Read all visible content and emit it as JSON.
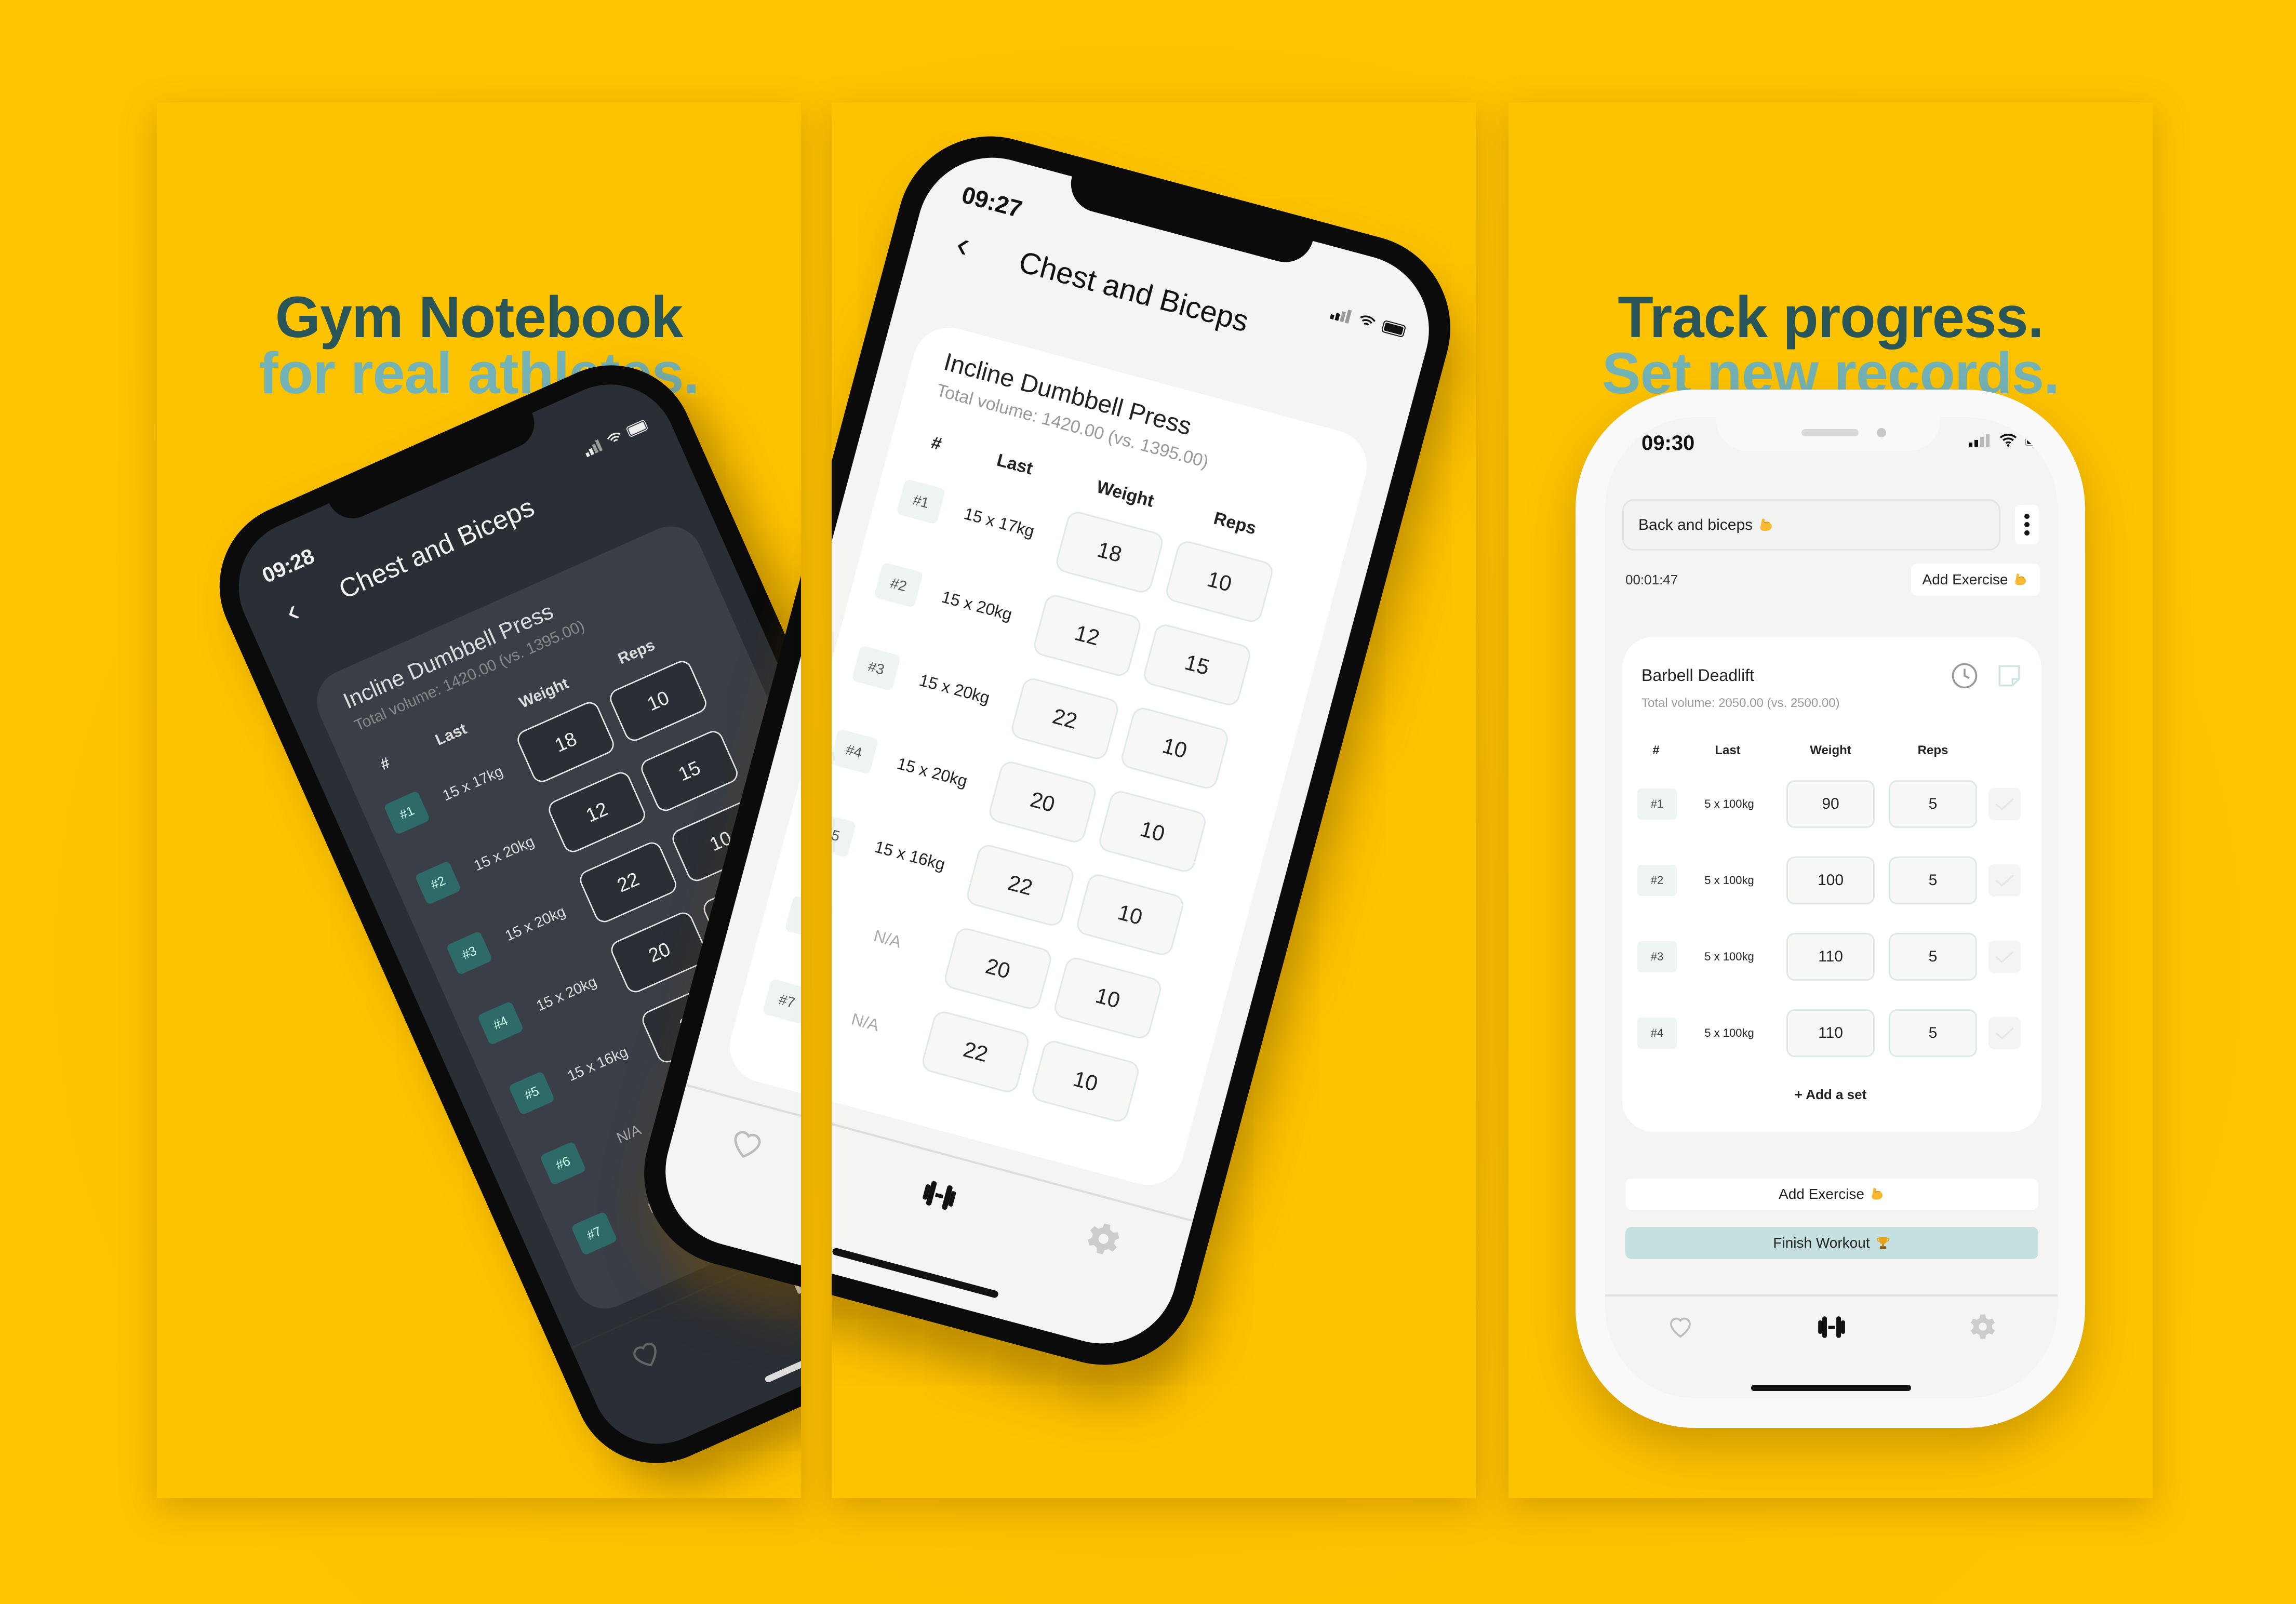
{
  "colors": {
    "background": "#fdc300",
    "headline_dark": "#2a5558",
    "headline_light": "#73b2b6",
    "finish_button": "#c5e0e1",
    "badge_dark": "#2e6a67"
  },
  "panel1": {
    "line1": "Gym Notebook",
    "line2": "for real athletes."
  },
  "panel3": {
    "line1": "Track progress.",
    "line2": "Set new records."
  },
  "dark_phone": {
    "time": "09:28",
    "title": "Chest and Biceps"
  },
  "middle_phone": {
    "time": "09:27",
    "title": "Chest and Biceps"
  },
  "rotated_workout": {
    "exercise": "Incline Dumbbell Press",
    "volume": "Total volume: 1420.00 (vs. 1395.00)",
    "headers": [
      "#",
      "Last",
      "Weight",
      "Reps"
    ],
    "sets": [
      {
        "n": "#1",
        "last": "15 x 17kg",
        "weight": "18",
        "reps": "10"
      },
      {
        "n": "#2",
        "last": "15 x 20kg",
        "weight": "12",
        "reps": "15"
      },
      {
        "n": "#3",
        "last": "15 x 20kg",
        "weight": "22",
        "reps": "10"
      },
      {
        "n": "#4",
        "last": "15 x 20kg",
        "weight": "20",
        "reps": "10"
      },
      {
        "n": "#5",
        "last": "15 x 16kg",
        "weight": "22",
        "reps": "10"
      },
      {
        "n": "#6",
        "last": "N/A",
        "weight": "20",
        "reps": "10"
      },
      {
        "n": "#7",
        "last": "N/A",
        "weight": "22",
        "reps": "10"
      }
    ]
  },
  "right_phone": {
    "time": "09:30",
    "workout_name": "Back and biceps",
    "workout_name_icon": "flexed-biceps",
    "timer": "00:01:47",
    "add_exercise_top": "Add Exercise",
    "exercise": "Barbell Deadlift",
    "volume": "Total volume: 2050.00 (vs. 2500.00)",
    "headers": [
      "#",
      "Last",
      "Weight",
      "Reps"
    ],
    "sets": [
      {
        "n": "#1",
        "last": "5 x 100kg",
        "weight": "90",
        "reps": "5"
      },
      {
        "n": "#2",
        "last": "5 x 100kg",
        "weight": "100",
        "reps": "5"
      },
      {
        "n": "#3",
        "last": "5 x 100kg",
        "weight": "110",
        "reps": "5"
      },
      {
        "n": "#4",
        "last": "5 x 100kg",
        "weight": "110",
        "reps": "5"
      }
    ],
    "add_set": "+ Add a set",
    "add_exercise": "Add Exercise",
    "finish": "Finish Workout",
    "finish_icon": "trophy",
    "tabs": [
      "heart",
      "dumbbell",
      "gear"
    ]
  }
}
